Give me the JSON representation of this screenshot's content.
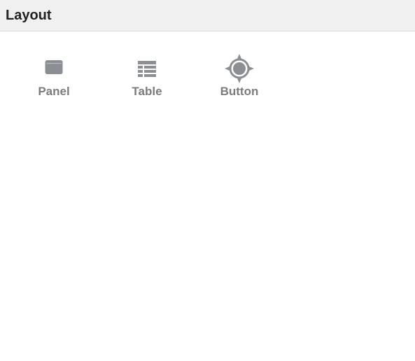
{
  "header": {
    "title": "Layout"
  },
  "palette": {
    "items": [
      {
        "label": "Panel",
        "icon": "panel-icon"
      },
      {
        "label": "Table",
        "icon": "table-icon"
      },
      {
        "label": "Button",
        "icon": "button-target-icon"
      }
    ]
  },
  "colors": {
    "header_bg": "#f0f0f0",
    "icon": "#8b8f94",
    "label": "#7a7d80",
    "title": "#222222"
  }
}
